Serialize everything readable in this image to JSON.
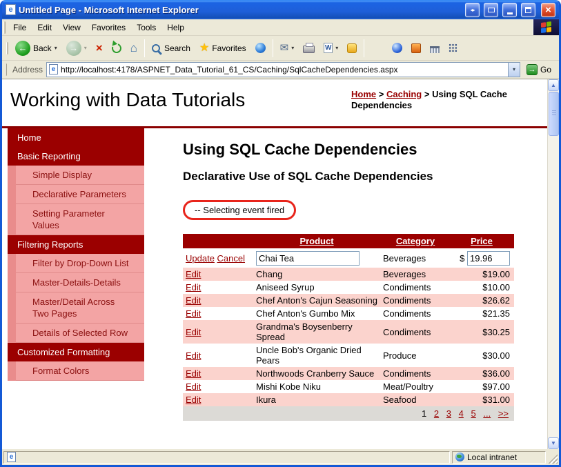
{
  "window": {
    "title": "Untitled Page - Microsoft Internet Explorer",
    "status_zone": "Local intranet"
  },
  "menu": {
    "items": [
      "File",
      "Edit",
      "View",
      "Favorites",
      "Tools",
      "Help"
    ]
  },
  "toolbar": {
    "back": "Back",
    "search": "Search",
    "favorites": "Favorites",
    "go": "Go",
    "address_label": "Address",
    "url": "http://localhost:4178/ASPNET_Data_Tutorial_61_CS/Caching/SqlCacheDependencies.aspx"
  },
  "page": {
    "site_title": "Working with Data Tutorials",
    "breadcrumb": {
      "home": "Home",
      "sep1": ">",
      "caching": "Caching",
      "sep2": ">",
      "current": "Using SQL Cache Dependencies"
    },
    "heading": "Using SQL Cache Dependencies",
    "subheading": "Declarative Use of SQL Cache Dependencies",
    "event_message": "-- Selecting event fired"
  },
  "sidebar": {
    "items": [
      {
        "label": "Home",
        "type": "section"
      },
      {
        "label": "Basic Reporting",
        "type": "section"
      },
      {
        "label": "Simple Display",
        "type": "sub"
      },
      {
        "label": "Declarative Parameters",
        "type": "sub"
      },
      {
        "label": "Setting Parameter Values",
        "type": "sub"
      },
      {
        "label": "Filtering Reports",
        "type": "section"
      },
      {
        "label": "Filter by Drop-Down List",
        "type": "sub"
      },
      {
        "label": "Master-Details-Details",
        "type": "sub"
      },
      {
        "label": "Master/Detail Across Two Pages",
        "type": "sub"
      },
      {
        "label": "Details of Selected Row",
        "type": "sub"
      },
      {
        "label": "Customized Formatting",
        "type": "section"
      },
      {
        "label": "Format Colors",
        "type": "sub"
      }
    ]
  },
  "grid": {
    "headers": {
      "product": "Product",
      "category": "Category",
      "price": "Price"
    },
    "edit_row": {
      "update": "Update",
      "cancel": "Cancel",
      "product": "Chai Tea",
      "category": "Beverages",
      "currency": "$",
      "price": "19.96"
    },
    "rows": [
      {
        "edit": "Edit",
        "product": "Chang",
        "category": "Beverages",
        "price": "$19.00"
      },
      {
        "edit": "Edit",
        "product": "Aniseed Syrup",
        "category": "Condiments",
        "price": "$10.00"
      },
      {
        "edit": "Edit",
        "product": "Chef Anton's Cajun Seasoning",
        "category": "Condiments",
        "price": "$26.62"
      },
      {
        "edit": "Edit",
        "product": "Chef Anton's Gumbo Mix",
        "category": "Condiments",
        "price": "$21.35"
      },
      {
        "edit": "Edit",
        "product": "Grandma's Boysenberry Spread",
        "category": "Condiments",
        "price": "$30.25"
      },
      {
        "edit": "Edit",
        "product": "Uncle Bob's Organic Dried Pears",
        "category": "Produce",
        "price": "$30.00"
      },
      {
        "edit": "Edit",
        "product": "Northwoods Cranberry Sauce",
        "category": "Condiments",
        "price": "$36.00"
      },
      {
        "edit": "Edit",
        "product": "Mishi Kobe Niku",
        "category": "Meat/Poultry",
        "price": "$97.00"
      },
      {
        "edit": "Edit",
        "product": "Ikura",
        "category": "Seafood",
        "price": "$31.00"
      }
    ],
    "pager": {
      "current": "1",
      "p2": "2",
      "p3": "3",
      "p4": "4",
      "p5": "5",
      "ellipsis": "...",
      "next": ">>"
    }
  }
}
